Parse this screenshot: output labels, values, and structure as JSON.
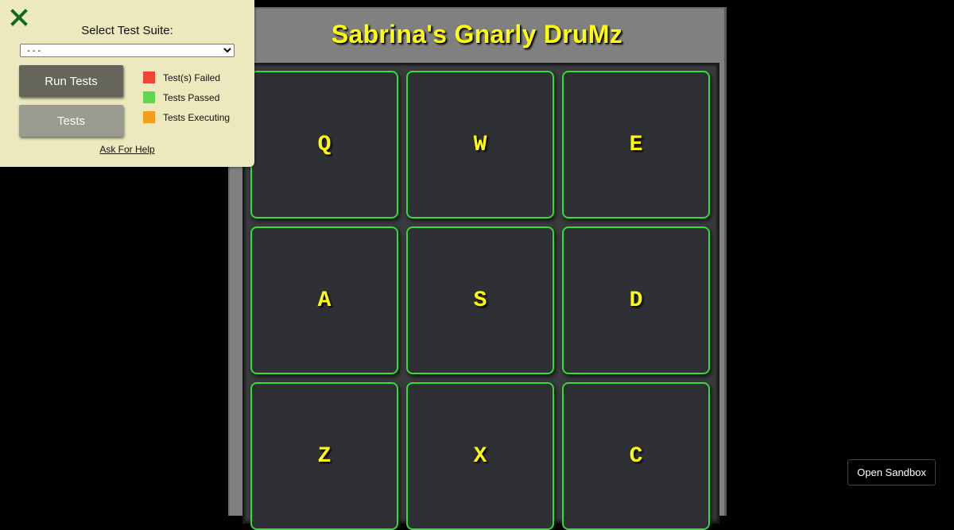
{
  "drum_machine": {
    "title": "Sabrina's Gnarly DruMz",
    "pads": [
      {
        "key": "Q"
      },
      {
        "key": "W"
      },
      {
        "key": "E"
      },
      {
        "key": "A"
      },
      {
        "key": "S"
      },
      {
        "key": "D"
      },
      {
        "key": "Z"
      },
      {
        "key": "X"
      },
      {
        "key": "C"
      }
    ]
  },
  "test_panel": {
    "suite_label": "Select Test Suite:",
    "suite_select_value": "- - -",
    "run_tests_label": "Run Tests",
    "tests_label": "Tests",
    "legend": [
      {
        "label": "Test(s) Failed",
        "color": "#f04436"
      },
      {
        "label": "Tests Passed",
        "color": "#5fd74f"
      },
      {
        "label": "Tests Executing",
        "color": "#f59e1b"
      }
    ],
    "help_link": "Ask For Help",
    "close_icon": "close-icon"
  },
  "sandbox_button": "Open Sandbox",
  "colors": {
    "pad_border": "#33dd33",
    "pad_text": "#ffff00",
    "title_text": "#ffff00",
    "panel_bg": "#ebe9bd",
    "close_icon": "#0f6b1a"
  }
}
